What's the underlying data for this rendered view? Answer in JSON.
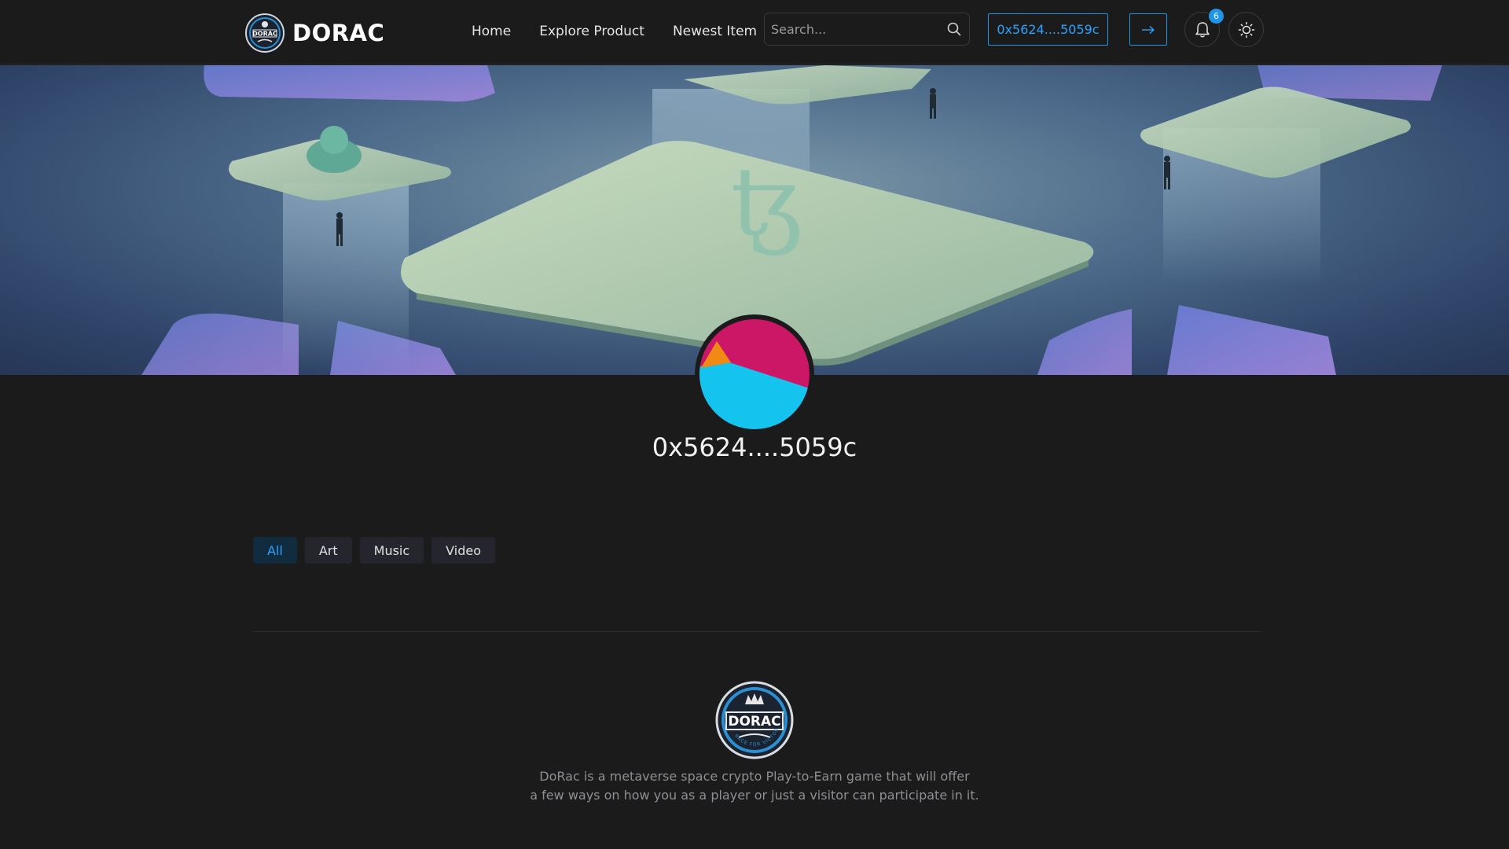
{
  "brand": {
    "name": "DORAC",
    "logo_text": "DORAC",
    "logo_tagline": "RACE FOR VICTORY"
  },
  "nav": {
    "items": [
      "Home",
      "Explore Product",
      "Newest Item"
    ]
  },
  "search": {
    "placeholder": "Search..."
  },
  "wallet": {
    "address": "0x5624....5059c"
  },
  "notifications": {
    "count": "6"
  },
  "profile": {
    "address": "0x5624....5059c"
  },
  "tabs": {
    "items": [
      "All",
      "Art",
      "Music",
      "Video"
    ],
    "active": "All"
  },
  "footer": {
    "description_line1": "DoRac is a metaverse space crypto Play-to-Earn game that will offer",
    "description_line2": "a few ways on how you as a player or just a visitor can participate in it."
  },
  "colors": {
    "accent": "#1e95e6",
    "background": "#1b1b1c",
    "avatar_pink": "#cc1766",
    "avatar_cyan": "#14c4ef",
    "avatar_orange": "#f08a14"
  }
}
